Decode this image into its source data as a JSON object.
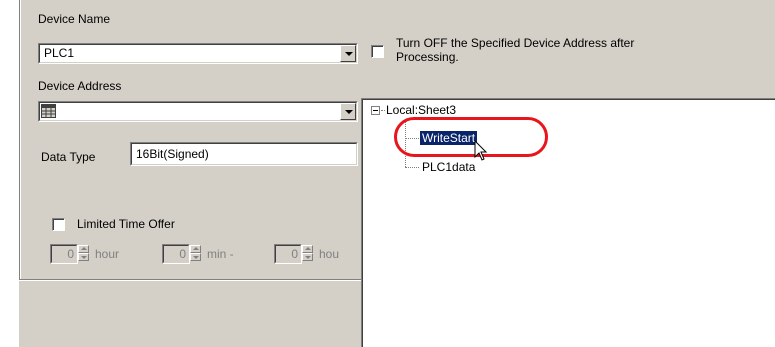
{
  "device_name": {
    "label": "Device Name",
    "value": "PLC1"
  },
  "turn_off": {
    "label_line1": "Turn OFF the Specified Device Address after",
    "label_line2": "Processing."
  },
  "device_address": {
    "label": "Device Address",
    "value": ""
  },
  "data_type": {
    "label": "Data Type",
    "value": "16Bit(Signed)"
  },
  "limited_time": {
    "label": "Limited Time Offer",
    "fields": [
      {
        "value": "0",
        "unit": "hour"
      },
      {
        "value": "0",
        "unit": "min -"
      },
      {
        "value": "0",
        "unit": "hou"
      }
    ]
  },
  "tree": {
    "root": "Local:Sheet3",
    "children": [
      "WriteStart",
      "PLC1data"
    ],
    "selected": "WriteStart"
  },
  "colors": {
    "highlight": "#e8151c",
    "selection": "#0a246a",
    "dialog_bg": "#d4d0c8"
  },
  "icons": {
    "address_picker": "grid-icon",
    "dropdown": "chevron-down-icon",
    "pointer": "mouse-cursor-icon"
  }
}
